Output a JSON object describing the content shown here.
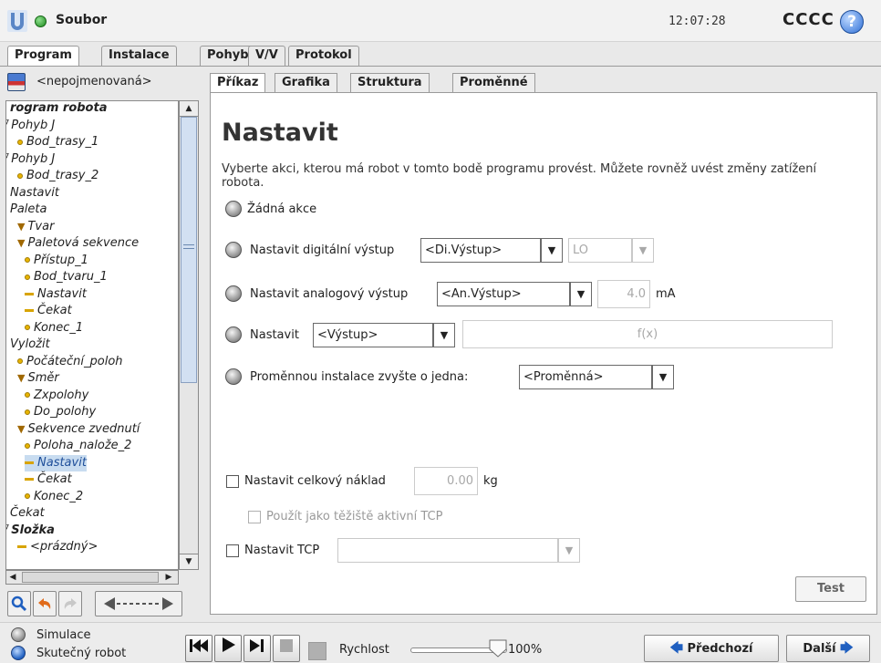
{
  "topbar": {
    "menu_title": "Soubor",
    "clock": "12:07:28",
    "robot_name": "CCCC",
    "help_glyph": "?"
  },
  "main_tabs": [
    "Program",
    "Instalace",
    "Pohyb",
    "V/V",
    "Protokol"
  ],
  "program": {
    "filename": "<nepojmenovaná>"
  },
  "tree": [
    {
      "label": "rogram robota",
      "bold": true
    },
    {
      "label": "Pohyb J"
    },
    {
      "label": "Bod_trasy_1"
    },
    {
      "label": "Pohyb J"
    },
    {
      "label": "Bod_trasy_2"
    },
    {
      "label": "Nastavit"
    },
    {
      "label": "Paleta"
    },
    {
      "label": "Tvar"
    },
    {
      "label": "Paletová sekvence"
    },
    {
      "label": "Přístup_1"
    },
    {
      "label": "Bod_tvaru_1"
    },
    {
      "label": "Nastavit"
    },
    {
      "label": "Čekat"
    },
    {
      "label": "Konec_1"
    },
    {
      "label": "Vyložit"
    },
    {
      "label": "Počáteční_poloh"
    },
    {
      "label": "Směr"
    },
    {
      "label": "Zxpolohy"
    },
    {
      "label": "Do_polohy"
    },
    {
      "label": "Sekvence zvednutí"
    },
    {
      "label": "Poloha_nalože_2"
    },
    {
      "label": "Nastavit",
      "selected": true
    },
    {
      "label": "Čekat"
    },
    {
      "label": "Konec_2"
    },
    {
      "label": "Čekat"
    },
    {
      "label": "Složka",
      "bold": true
    },
    {
      "label": "<prázdný>"
    }
  ],
  "sub_tabs": [
    "Příkaz",
    "Grafika",
    "Struktura",
    "Proměnné"
  ],
  "content": {
    "title": "Nastavit",
    "description": "Vyberte akci, kterou má robot v tomto bodě programu provést. Můžete rovněž uvést změny zatížení robota.",
    "option_none": "Žádná akce",
    "option_digital": "Nastavit digitální výstup",
    "digital_select": "<Di.Výstup>",
    "digital_value": "LO",
    "option_analog": "Nastavit analogový výstup",
    "analog_select": "<An.Výstup>",
    "analog_value": "4.0",
    "analog_unit": "mA",
    "option_expr": "Nastavit",
    "expr_select": "<Výstup>",
    "expr_field": "f(x)",
    "option_increment": "Proměnnou instalace zvyšte o jedna:",
    "increment_select": "<Proměnná>",
    "payload_label": "Nastavit celkový náklad",
    "payload_value": "0.00",
    "payload_unit": "kg",
    "cog_label": "Použít jako těžiště aktivní TCP",
    "tcp_label": "Nastavit TCP",
    "test_button": "Test"
  },
  "bottombar": {
    "simulation": "Simulace",
    "real_robot": "Skutečný robot",
    "speed_label": "Rychlost",
    "speed_value": "100%",
    "speed_fraction": 1.0,
    "prev_button": "Předchozí",
    "next_button": "Další"
  }
}
